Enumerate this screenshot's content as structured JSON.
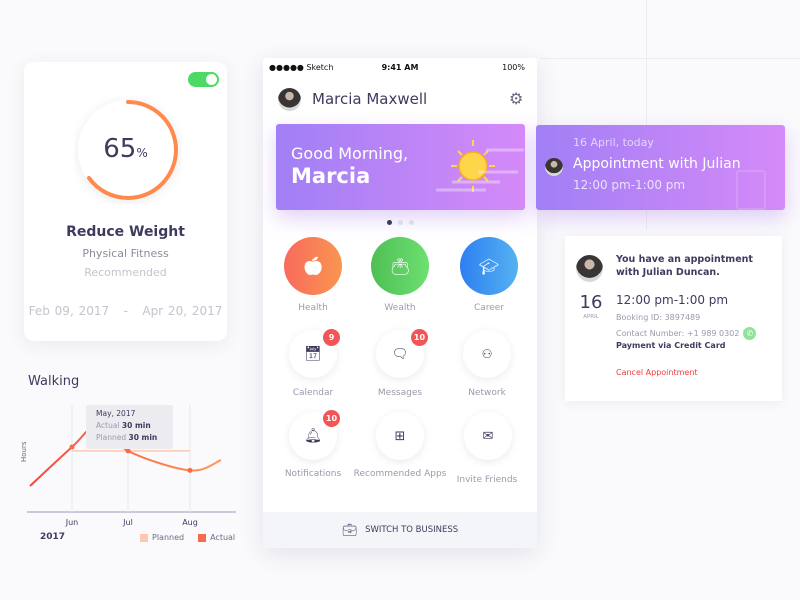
{
  "fitness_card": {
    "toggle_on": true,
    "progress_percent": 65,
    "value": "65",
    "unit": "%",
    "title": "Reduce Weight",
    "category": "Physical Fitness",
    "tag": "Recommended",
    "start_date": "Feb 09, 2017",
    "separator": "-",
    "end_date": "Apr 20, 2017",
    "accent": "#ff8a4c"
  },
  "walking": {
    "title": "Walking",
    "year": "2017",
    "tooltip": {
      "date": "May, 2017",
      "actual_label": "Actual",
      "actual_value": "30 min",
      "planned_label": "Planned",
      "planned_value": "30 min"
    }
  },
  "chart_data": {
    "type": "line",
    "ylabel": "Hours",
    "categories": [
      "Jun",
      "Jul",
      "Aug"
    ],
    "legend": "bottom-right",
    "series": [
      {
        "name": "Planned",
        "color": "#fcc9b0",
        "points": [
          [
            6,
            0.47
          ],
          [
            8,
            0.47
          ]
        ]
      },
      {
        "name": "Actual",
        "color": "#f76a4a",
        "points": [
          [
            5.25,
            0.2
          ],
          [
            6,
            0.5
          ],
          [
            6.5,
            0.68
          ],
          [
            7,
            0.47
          ],
          [
            8,
            0.32
          ],
          [
            8.5,
            0.4
          ]
        ]
      }
    ]
  },
  "phone": {
    "status": {
      "carrier": "●●●●● Sketch",
      "time": "9:41 AM",
      "battery": "100%"
    },
    "user_name": "Marcia Maxwell",
    "greeting": "Good Morning,",
    "greeting_name": "Marcia",
    "pager": {
      "count": 3,
      "active": 0
    },
    "categories": [
      {
        "label": "Health",
        "icon": "health-icon",
        "color": "#f96a5e"
      },
      {
        "label": "Wealth",
        "icon": "wallet-icon",
        "color": "#5ccd62"
      },
      {
        "label": "Career",
        "icon": "graduation-cap-icon",
        "color": "#3a8ff0"
      }
    ],
    "apps": [
      {
        "label": "Calendar",
        "badge": "9"
      },
      {
        "label": "Messages",
        "badge": "10"
      },
      {
        "label": "Network",
        "badge": ""
      },
      {
        "label": "Notifications",
        "badge": "10"
      },
      {
        "label": "Recommended Apps",
        "badge": ""
      },
      {
        "label": "Invite Friends",
        "badge": ""
      }
    ],
    "switch_label": "SWITCH TO BUSINESS"
  },
  "appointment_banner": {
    "date": "16 April, today",
    "title": "Appointment with Julian",
    "time": "12:00 pm-1:00 pm"
  },
  "appointment_detail": {
    "message": "You have an appointment with Julian Duncan.",
    "day": "16",
    "month": "APRIL",
    "time": "12:00 pm-1:00 pm",
    "booking": "Booking ID: 3897489",
    "contact": "Contact Number: +1 989 0302",
    "payment": "Payment via Credit Card",
    "cancel": "Cancel Appointment"
  }
}
